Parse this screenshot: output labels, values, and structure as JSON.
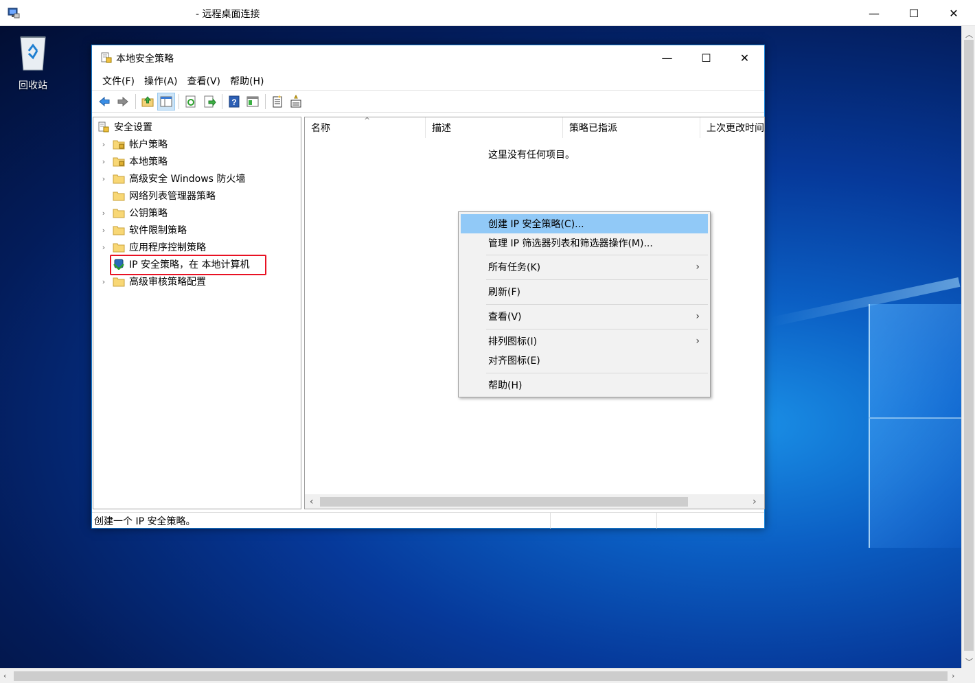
{
  "rdp": {
    "title": "- 远程桌面连接",
    "minimize": "—",
    "maximize": "☐",
    "close": "✕"
  },
  "desktop": {
    "recycle_bin": "回收站"
  },
  "mmc": {
    "title": "本地安全策略",
    "minimize": "—",
    "maximize": "☐",
    "close": "✕",
    "menu": [
      "文件(F)",
      "操作(A)",
      "查看(V)",
      "帮助(H)"
    ],
    "toolbar_icons": [
      "back-icon",
      "forward-icon",
      "up-folder-icon",
      "show-tree-icon",
      "refresh-icon",
      "export-icon",
      "help-icon",
      "details-icon",
      "new-policy-icon",
      "properties-icon"
    ]
  },
  "tree": {
    "root": "安全设置",
    "items": [
      {
        "label": "帐户策略",
        "expandable": true
      },
      {
        "label": "本地策略",
        "expandable": true
      },
      {
        "label": "高级安全 Windows 防火墙",
        "expandable": true
      },
      {
        "label": "网络列表管理器策略",
        "expandable": false
      },
      {
        "label": "公钥策略",
        "expandable": true
      },
      {
        "label": "软件限制策略",
        "expandable": true
      },
      {
        "label": "应用程序控制策略",
        "expandable": true
      },
      {
        "label": "IP 安全策略，在 本地计算机",
        "expandable": false,
        "selected": true
      },
      {
        "label": "高级审核策略配置",
        "expandable": true
      }
    ]
  },
  "list": {
    "columns": [
      "名称",
      "描述",
      "策略已指派",
      "上次更改时间"
    ],
    "empty_text": "这里没有任何项目。"
  },
  "status": {
    "text": "创建一个 IP 安全策略。"
  },
  "context_menu": {
    "items": [
      {
        "label": "创建 IP 安全策略(C)...",
        "highlighted": true
      },
      {
        "label": "管理 IP 筛选器列表和筛选器操作(M)..."
      },
      {
        "label": "所有任务(K)",
        "submenu": true
      },
      {
        "label": "刷新(F)"
      },
      {
        "label": "查看(V)",
        "submenu": true
      },
      {
        "label": "排列图标(I)",
        "submenu": true
      },
      {
        "label": "对齐图标(E)"
      },
      {
        "label": "帮助(H)"
      }
    ],
    "submenu_arrow": "›"
  }
}
